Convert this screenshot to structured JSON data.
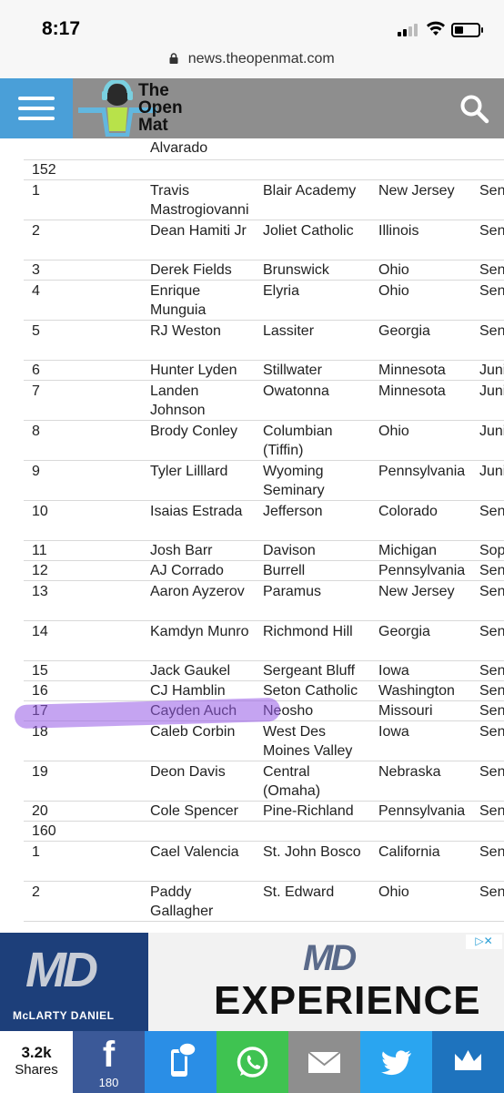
{
  "status": {
    "time": "8:17"
  },
  "browser": {
    "url": "news.theopenmat.com"
  },
  "header": {
    "logo_line1": "The",
    "logo_line2": "Open",
    "logo_line3": "Mat"
  },
  "table": {
    "rows": [
      {
        "kind": "cont",
        "rank": "",
        "name": "Alvarado",
        "school": "",
        "state": "",
        "grade": ""
      },
      {
        "kind": "weight",
        "rank": "152",
        "name": "",
        "school": "",
        "state": "",
        "grade": ""
      },
      {
        "kind": "r2",
        "rank": "1",
        "name": "Travis Mastrogiovanni",
        "school": "Blair Academy",
        "state": "New Jersey",
        "grade": "Sen"
      },
      {
        "kind": "r2",
        "rank": "2",
        "name": "Dean Hamiti Jr",
        "school": "Joliet Catholic",
        "state": "Illinois",
        "grade": "Sen"
      },
      {
        "kind": "r1",
        "rank": "3",
        "name": "Derek Fields",
        "school": "Brunswick",
        "state": "Ohio",
        "grade": "Sen"
      },
      {
        "kind": "r2",
        "rank": "4",
        "name": "Enrique Munguia",
        "school": "Elyria",
        "state": "Ohio",
        "grade": "Sen"
      },
      {
        "kind": "r2",
        "rank": "5",
        "name": "RJ Weston",
        "school": "Lassiter",
        "state": "Georgia",
        "grade": "Sen"
      },
      {
        "kind": "r1",
        "rank": "6",
        "name": "Hunter Lyden",
        "school": "Stillwater",
        "state": "Minnesota",
        "grade": "Juni"
      },
      {
        "kind": "r2",
        "rank": "7",
        "name": "Landen Johnson",
        "school": "Owatonna",
        "state": "Minnesota",
        "grade": "Juni"
      },
      {
        "kind": "r2",
        "rank": "8",
        "name": "Brody Conley",
        "school": "Columbian (Tiffin)",
        "state": "Ohio",
        "grade": "Juni"
      },
      {
        "kind": "r2",
        "rank": "9",
        "name": "Tyler Lilllard",
        "school": "Wyoming Seminary",
        "state": "Pennsylvania",
        "grade": "Juni"
      },
      {
        "kind": "r2",
        "rank": "10",
        "name": "Isaias Estrada",
        "school": "Jefferson",
        "state": "Colorado",
        "grade": "Sen"
      },
      {
        "kind": "r1",
        "rank": "11",
        "name": "Josh Barr",
        "school": "Davison",
        "state": "Michigan",
        "grade": "Sop"
      },
      {
        "kind": "r1",
        "rank": "12",
        "name": "AJ Corrado",
        "school": "Burrell",
        "state": "Pennsylvania",
        "grade": "Sen"
      },
      {
        "kind": "r2",
        "rank": "13",
        "name": "Aaron Ayzerov",
        "school": "Paramus",
        "state": "New Jersey",
        "grade": "Sen"
      },
      {
        "kind": "r2",
        "rank": "14",
        "name": "Kamdyn Munro",
        "school": "Richmond Hill",
        "state": "Georgia",
        "grade": "Sen"
      },
      {
        "kind": "r1",
        "rank": "15",
        "name": "Jack Gaukel",
        "school": "Sergeant Bluff",
        "state": "Iowa",
        "grade": "Sen"
      },
      {
        "kind": "r1",
        "rank": "16",
        "name": "CJ Hamblin",
        "school": "Seton Catholic",
        "state": "Washington",
        "grade": "Sen"
      },
      {
        "kind": "r1",
        "rank": "17",
        "name": "Cayden Auch",
        "school": "Neosho",
        "state": "Missouri",
        "grade": "Sen"
      },
      {
        "kind": "r2",
        "rank": "18",
        "name": "Caleb Corbin",
        "school": "West Des Moines Valley",
        "state": "Iowa",
        "grade": "Sen"
      },
      {
        "kind": "r2",
        "rank": "19",
        "name": "Deon Davis",
        "school": "Central (Omaha)",
        "state": "Nebraska",
        "grade": "Sen"
      },
      {
        "kind": "r1",
        "rank": "20",
        "name": "Cole Spencer",
        "school": "Pine-Richland",
        "state": "Pennsylvania",
        "grade": "Sen"
      },
      {
        "kind": "weight",
        "rank": "160",
        "name": "",
        "school": "",
        "state": "",
        "grade": ""
      },
      {
        "kind": "r2",
        "rank": "1",
        "name": "Cael Valencia",
        "school": "St. John Bosco",
        "state": "California",
        "grade": "Sen"
      },
      {
        "kind": "r2",
        "rank": "2",
        "name": "Paddy Gallagher",
        "school": "St. Edward",
        "state": "Ohio",
        "grade": "Sen"
      }
    ]
  },
  "ad": {
    "logo": "MD",
    "brand": "McLARTY DANIEL",
    "headline_mark": "MD",
    "headline": "EXPERIENCE",
    "choices": "▷✕"
  },
  "share": {
    "count": "3.2k",
    "label": "Shares",
    "facebook_count": "180",
    "facebook_glyph": "f",
    "colors": {
      "facebook": "#3b5998",
      "sms": "#2a8ee6",
      "whatsapp": "#3fc351",
      "email": "#8e8e8e",
      "twitter": "#2aa5f0",
      "crown": "#1e73be"
    }
  }
}
